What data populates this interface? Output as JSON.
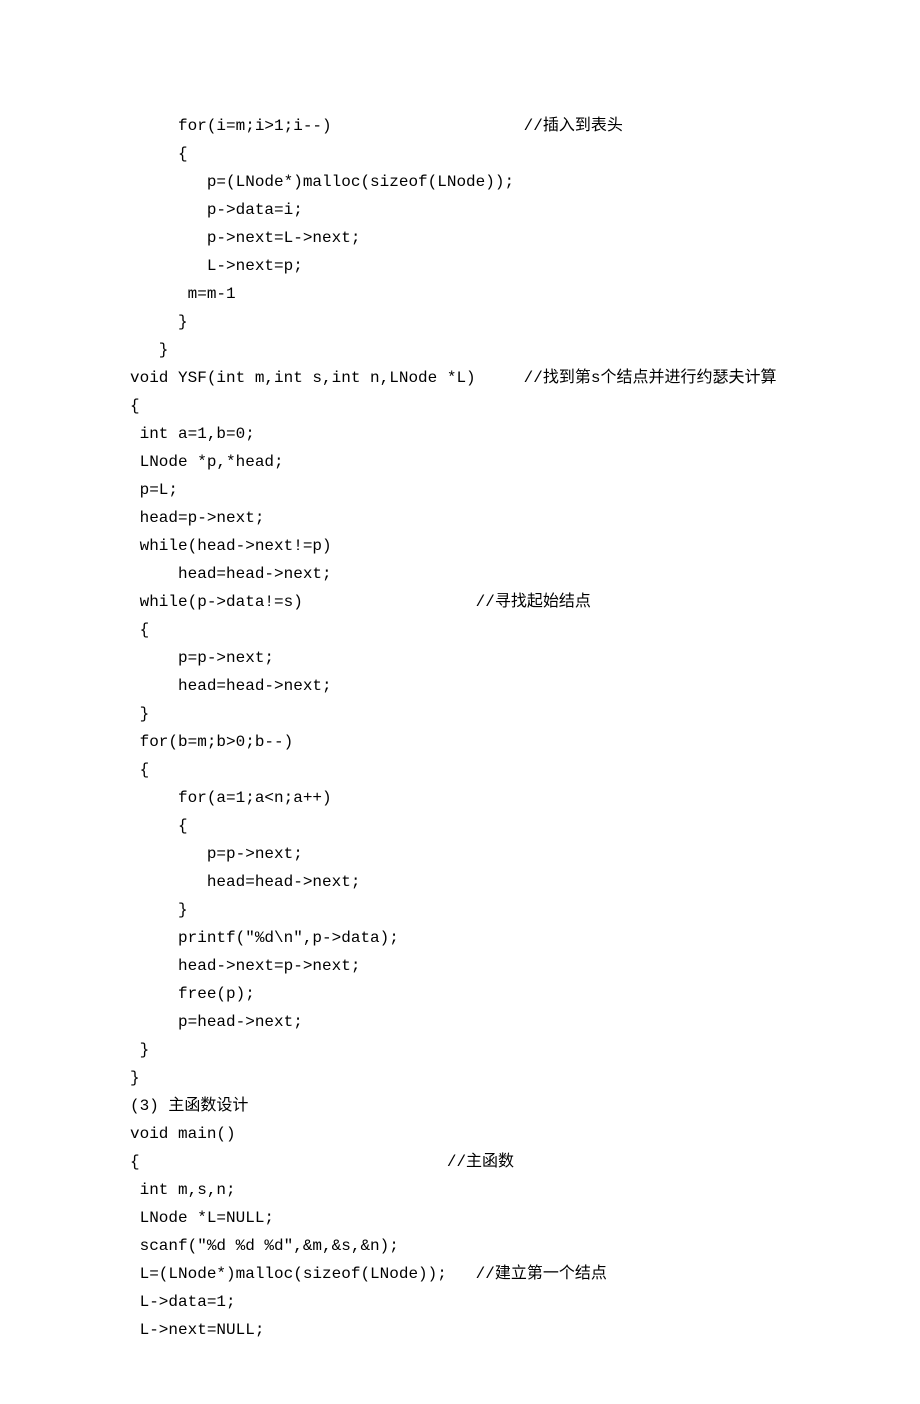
{
  "lines": [
    "     for(i=m;i>1;i--)                    //插入到表头",
    "     {",
    "        p=(LNode*)malloc(sizeof(LNode));",
    "        p->data=i;",
    "        p->next=L->next;",
    "        L->next=p;",
    "      m=m-1",
    "     } ",
    "   }",
    "void YSF(int m,int s,int n,LNode *L)     //找到第s个结点并进行约瑟夫计算",
    "{",
    " int a=1,b=0;",
    " LNode *p,*head;",
    " p=L;",
    " head=p->next;",
    " while(head->next!=p)",
    "     head=head->next;",
    " while(p->data!=s)                  //寻找起始结点",
    " {",
    "     p=p->next;",
    "     head=head->next;",
    " }",
    " for(b=m;b>0;b--)",
    " {    ",
    "     for(a=1;a<n;a++)",
    "     {",
    "        p=p->next;",
    "        head=head->next;",
    "     }",
    "     printf(\"%d\\n\",p->data);",
    "     head->next=p->next;",
    "     free(p);",
    "     p=head->next;",
    " }",
    "}",
    "(3) 主函数设计",
    "void main()",
    "{                                //主函数",
    " int m,s,n;",
    " LNode *L=NULL;",
    " scanf(\"%d %d %d\",&m,&s,&n);",
    " L=(LNode*)malloc(sizeof(LNode));   //建立第一个结点",
    " L->data=1;",
    " L->next=NULL;"
  ]
}
